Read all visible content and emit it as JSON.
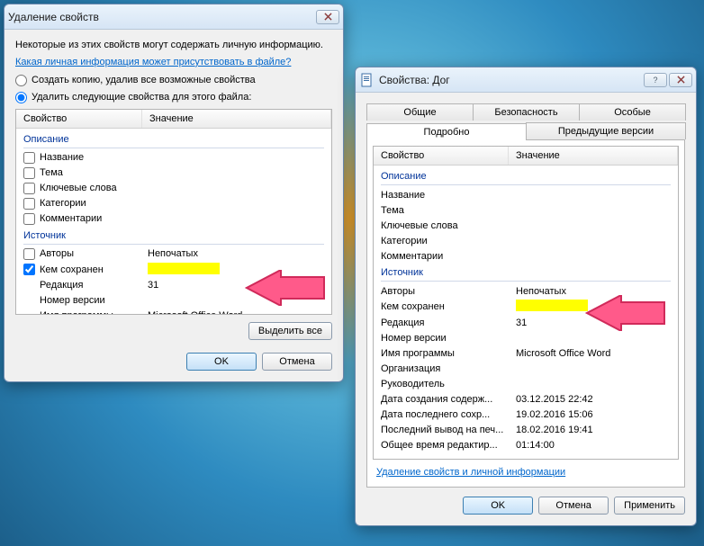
{
  "remove": {
    "title": "Удаление свойств",
    "hint": "Некоторые из этих свойств могут содержать личную информацию.",
    "hint_link": "Какая личная информация может присутствовать в файле?",
    "radio_copy": "Создать копию, удалив все возможные свойства",
    "radio_remove": "Удалить следующие свойства для этого файла:",
    "col_prop": "Свойство",
    "col_val": "Значение",
    "group_description": "Описание",
    "group_source": "Источник",
    "items_desc": [
      {
        "label": "Название",
        "value": ""
      },
      {
        "label": "Тема",
        "value": ""
      },
      {
        "label": "Ключевые слова",
        "value": ""
      },
      {
        "label": "Категории",
        "value": ""
      },
      {
        "label": "Комментарии",
        "value": ""
      }
    ],
    "items_src": [
      {
        "label": "Авторы",
        "value": "Непочатых",
        "checked": false
      },
      {
        "label": "Кем сохранен",
        "value": "[HL]",
        "checked": true
      },
      {
        "label": "Редакция",
        "value": "31",
        "checked": false,
        "nochk": true
      },
      {
        "label": "Номер версии",
        "value": "",
        "checked": false,
        "nochk": true
      },
      {
        "label": "Имя программы",
        "value": "Microsoft Office Word",
        "checked": false,
        "nochk": true
      }
    ],
    "select_all": "Выделить все",
    "ok": "OK",
    "cancel": "Отмена"
  },
  "props": {
    "title": "Свойства: Дог",
    "tabs_top": [
      "Общие",
      "Безопасность",
      "Особые"
    ],
    "tabs_bottom": [
      "Подробно",
      "Предыдущие версии"
    ],
    "col_prop": "Свойство",
    "col_val": "Значение",
    "group_description": "Описание",
    "group_source": "Источник",
    "desc": [
      {
        "label": "Название",
        "value": ""
      },
      {
        "label": "Тема",
        "value": ""
      },
      {
        "label": "Ключевые слова",
        "value": ""
      },
      {
        "label": "Категории",
        "value": ""
      },
      {
        "label": "Комментарии",
        "value": ""
      }
    ],
    "src": [
      {
        "label": "Авторы",
        "value": "Непочатых"
      },
      {
        "label": "Кем сохранен",
        "value": "[HL]"
      },
      {
        "label": "Редакция",
        "value": "31"
      },
      {
        "label": "Номер версии",
        "value": ""
      },
      {
        "label": "Имя программы",
        "value": "Microsoft Office Word"
      },
      {
        "label": "Организация",
        "value": ""
      },
      {
        "label": "Руководитель",
        "value": ""
      },
      {
        "label": "Дата создания содерж...",
        "value": "03.12.2015 22:42"
      },
      {
        "label": "Дата последнего сохр...",
        "value": "19.02.2016 15:06"
      },
      {
        "label": "Последний вывод на печ...",
        "value": "18.02.2016 19:41"
      },
      {
        "label": "Общее время редактир...",
        "value": "01:14:00"
      }
    ],
    "remove_link": "Удаление свойств и личной информации",
    "ok": "OK",
    "cancel": "Отмена",
    "apply": "Применить"
  }
}
